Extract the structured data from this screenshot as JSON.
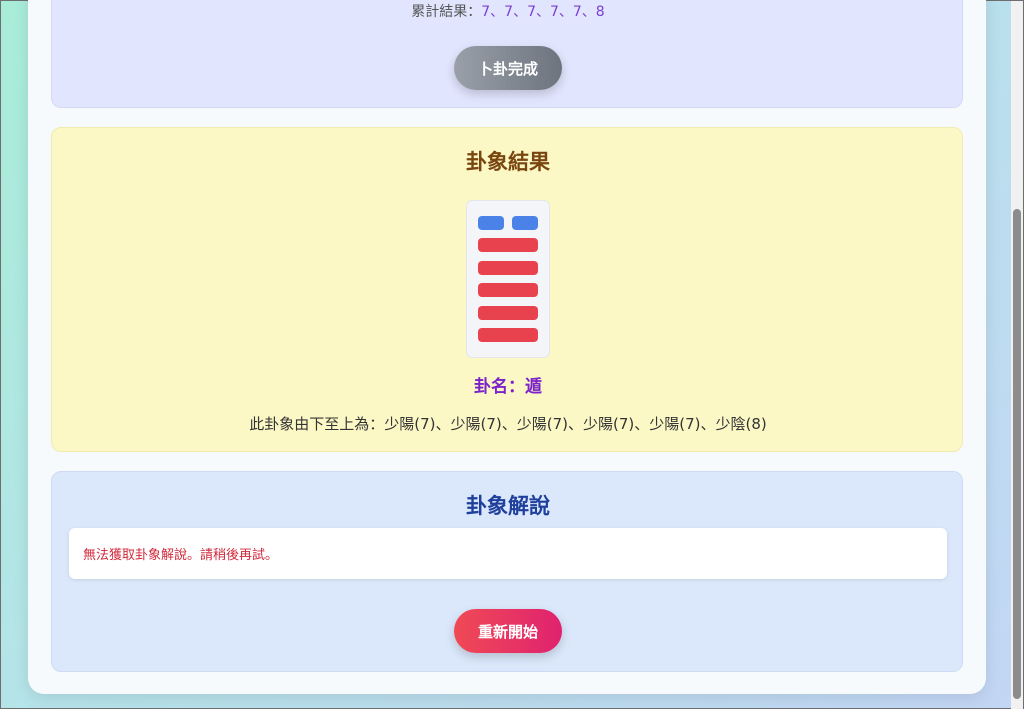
{
  "divination": {
    "cumulative_label": "累計結果：",
    "cumulative_values": "7、7、7、7、7、8",
    "done_button": "卜卦完成"
  },
  "result": {
    "title": "卦象結果",
    "hexagram_lines_top_to_bottom": [
      "yin",
      "yang",
      "yang",
      "yang",
      "yang",
      "yang"
    ],
    "hexagram_name": "卦名：遁",
    "description": "此卦象由下至上為：少陽(7)、少陽(7)、少陽(7)、少陽(7)、少陽(7)、少陰(8)"
  },
  "explanation": {
    "title": "卦象解說",
    "error_message": "無法獲取卦象解說。請稍後再試。",
    "restart_button": "重新開始"
  },
  "colors": {
    "yang_line": "#e8424f",
    "yin_line": "#4b82e8",
    "hexagram_name": "#7b22c9",
    "error_text": "#d0293a"
  }
}
